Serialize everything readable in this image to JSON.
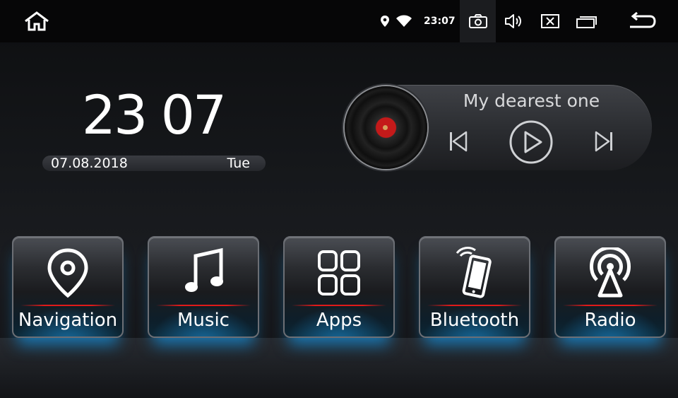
{
  "status_bar": {
    "time": "23:07",
    "icons": [
      "home-icon",
      "location-icon",
      "wifi-icon",
      "camera-icon",
      "volume-icon",
      "close-window-icon",
      "multitask-icon",
      "back-icon"
    ]
  },
  "clock": {
    "time": "23 07",
    "date": "07.08.2018",
    "day": "Tue"
  },
  "player": {
    "song_title": "My dearest one",
    "controls": [
      "previous-icon",
      "play-icon",
      "next-icon"
    ]
  },
  "tiles": [
    {
      "label": "Navigation",
      "icon": "map-pin-icon"
    },
    {
      "label": "Music",
      "icon": "music-note-icon"
    },
    {
      "label": "Apps",
      "icon": "apps-grid-icon"
    },
    {
      "label": "Bluetooth",
      "icon": "phone-signal-icon"
    },
    {
      "label": "Radio",
      "icon": "radio-tower-icon"
    }
  ],
  "colors": {
    "accent_glow": "#1ea0f0",
    "accent_line": "#e01a1a",
    "background": "#15171a"
  }
}
